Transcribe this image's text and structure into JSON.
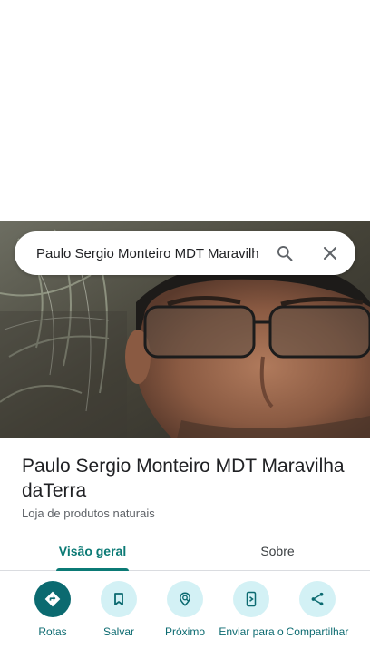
{
  "search": {
    "query": "Paulo Sergio Monteiro MDT Maravilha daTerra"
  },
  "place": {
    "name": "Paulo Sergio Monteiro MDT Maravilha daTerra",
    "category": "Loja de produtos naturais"
  },
  "tabs": [
    {
      "label": "Visão geral",
      "active": true
    },
    {
      "label": "Sobre",
      "active": false
    }
  ],
  "actions": [
    {
      "label": "Rotas",
      "icon": "directions-icon"
    },
    {
      "label": "Salvar",
      "icon": "bookmark-icon"
    },
    {
      "label": "Próximo",
      "icon": "nearby-icon"
    },
    {
      "label": "Enviar para o",
      "icon": "send-to-phone-icon"
    },
    {
      "label": "Compartilhar",
      "icon": "share-icon"
    }
  ],
  "colors": {
    "accent": "#0b7a75",
    "action_bg": "#d3f1f5",
    "primary_action_bg": "#0b6a70"
  }
}
